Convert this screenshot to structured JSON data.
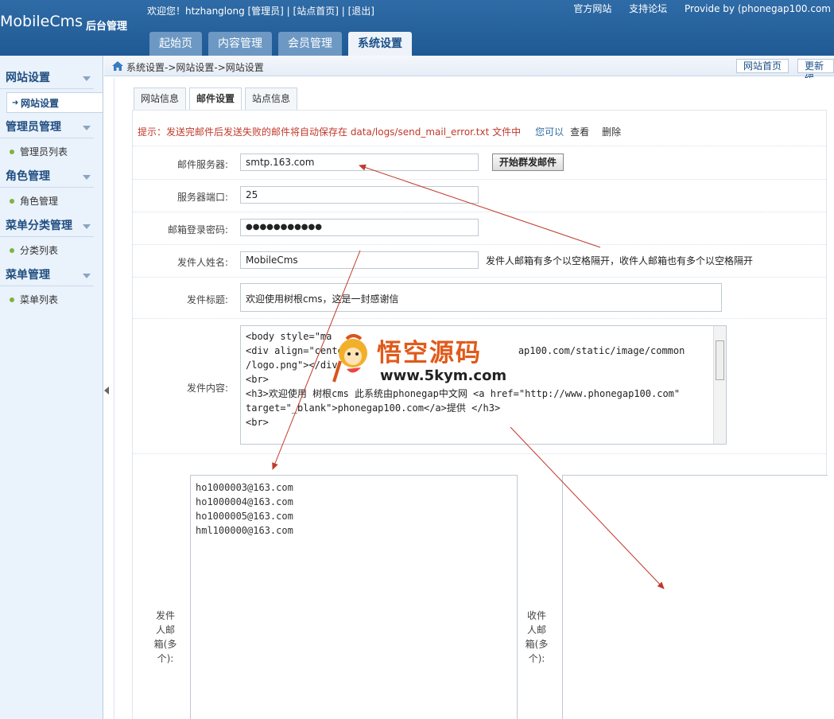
{
  "header": {
    "brand": "MobileCms",
    "brand_sub": "后台管理",
    "welcome": "欢迎您！htzhanglong [管理员] | [站点首页] | [退出]",
    "links": [
      "官方网站",
      "支持论坛",
      "Provide by (phonegap100.com"
    ],
    "nav": [
      "起始页",
      "内容管理",
      "会员管理",
      "系统设置"
    ],
    "active_nav": "系统设置"
  },
  "sidebar": {
    "sections": [
      {
        "title": "网站设置",
        "items": [
          "网站设置"
        ]
      },
      {
        "title": "管理员管理",
        "items": [
          "管理员列表"
        ]
      },
      {
        "title": "角色管理",
        "items": [
          "角色管理"
        ]
      },
      {
        "title": "菜单分类管理",
        "items": [
          "分类列表"
        ]
      },
      {
        "title": "菜单管理",
        "items": [
          "菜单列表"
        ]
      }
    ]
  },
  "breadcrumb": "系统设置->网站设置->网站设置",
  "top_buttons": [
    "网站首页",
    "更新缓"
  ],
  "tabs": [
    "网站信息",
    "邮件设置",
    "站点信息"
  ],
  "active_tab": "邮件设置",
  "tip": {
    "text": "提示：发送完邮件后发送失败的邮件将自动保存在 data/logs/send_mail_error.txt 文件中",
    "you_can": "您可以",
    "view": "查看",
    "delete": "删除"
  },
  "form": {
    "smtp_label": "邮件服务器:",
    "smtp_value": "smtp.163.com",
    "send_button": "开始群发邮件",
    "port_label": "服务器端口:",
    "port_value": "25",
    "password_label": "邮箱登录密码:",
    "password_value": "●●●●●●●●●●●",
    "sender_name_label": "发件人姓名:",
    "sender_name_value": "MobileCms",
    "sender_hint": "发件人邮箱有多个以空格隔开，收件人邮箱也有多个以空格隔开",
    "subject_label": "发件标题:",
    "subject_value": "欢迎使用树根cms，这是一封感谢信",
    "content_label": "发件内容:",
    "content_lines": [
      "<body style=\"ma",
      "<div align=\"cente",
      "/logo.png\"></div",
      "<br>",
      " <h3>欢迎使用 树根cms 此系统由phonegap中文网 <a href=\"http://www.phonegap100.com\"",
      "target=\"_blank\">phonegap100.com</a>提供 </h3>",
      "<br>"
    ],
    "content_tail": "ap100.com/static/image/common",
    "senders_label": "发件人邮箱(多个):",
    "senders": [
      "ho1000003@163.com",
      "ho1000004@163.com",
      "ho1000005@163.com",
      "hml100000@163.com"
    ],
    "receivers_label": "收件人邮箱(多个):"
  },
  "watermark": {
    "title": "悟空源码",
    "url": "www.5kym.com"
  },
  "colors": {
    "header": "#2f6ba6",
    "tip": "#c0392b",
    "sidebar": "#eaf2fb",
    "arrow": "#c0392b"
  }
}
